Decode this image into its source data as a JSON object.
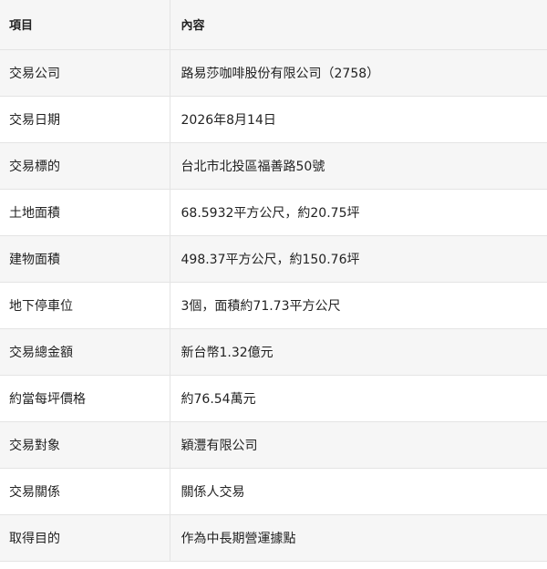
{
  "table": {
    "headers": [
      "項目",
      "內容"
    ],
    "rows": [
      {
        "label": "交易公司",
        "value": "路易莎咖啡股份有限公司（2758）"
      },
      {
        "label": "交易日期",
        "value": "2026年8月14日"
      },
      {
        "label": "交易標的",
        "value": "台北市北投區福善路50號"
      },
      {
        "label": "土地面積",
        "value": "68.5932平方公尺，約20.75坪"
      },
      {
        "label": "建物面積",
        "value": "498.37平方公尺，約150.76坪"
      },
      {
        "label": "地下停車位",
        "value": "3個，面積約71.73平方公尺"
      },
      {
        "label": "交易總金額",
        "value": "新台幣1.32億元"
      },
      {
        "label": "約當每坪價格",
        "value": "約76.54萬元"
      },
      {
        "label": "交易對象",
        "value": "穎灃有限公司"
      },
      {
        "label": "交易關係",
        "value": "關係人交易"
      },
      {
        "label": "取得目的",
        "value": "作為中長期營運據點"
      }
    ]
  }
}
